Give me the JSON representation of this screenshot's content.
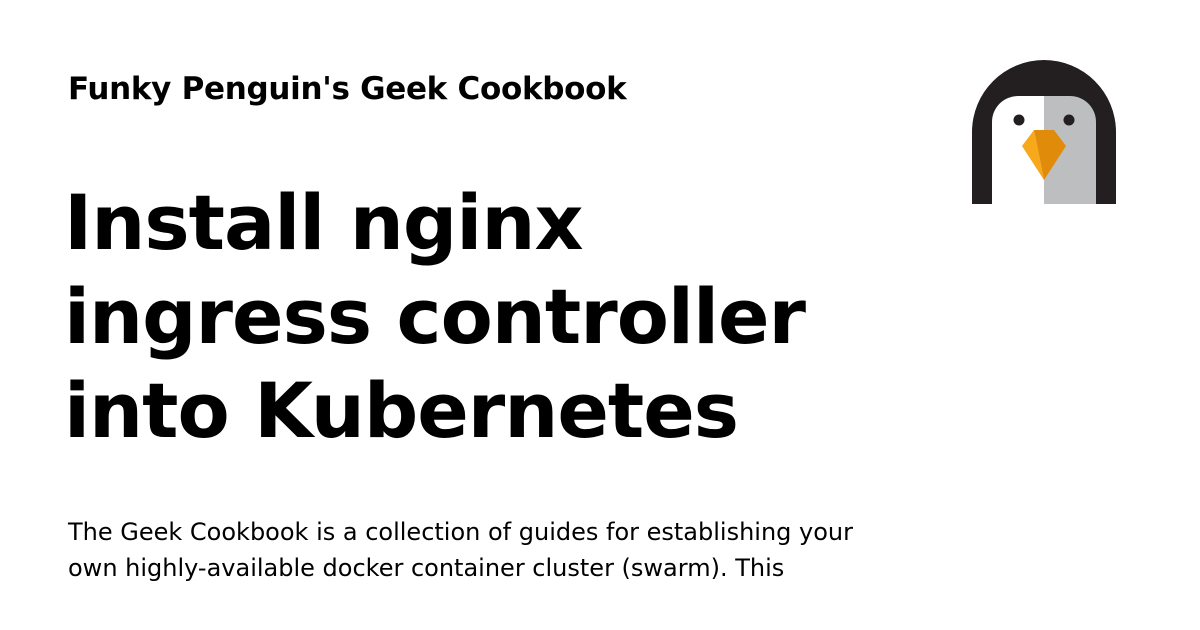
{
  "site": {
    "name": "Funky Penguin's Geek Cookbook"
  },
  "page": {
    "title_lines": [
      "Install nginx",
      "ingress controller",
      "into Kubernetes"
    ],
    "description_lines": [
      "The Geek Cookbook is a collection of guides for establishing your",
      "own highly-available docker container cluster (swarm). This"
    ]
  },
  "logo": {
    "icon": "penguin-logo-icon",
    "colors": {
      "outline": "#231f20",
      "face_left": "#ffffff",
      "face_right": "#bcbec0",
      "eye": "#231f20",
      "beak_light": "#f7a81b",
      "beak_dark": "#e08c0a"
    }
  },
  "colors": {
    "background": "#ffffff",
    "text": "#000000"
  }
}
